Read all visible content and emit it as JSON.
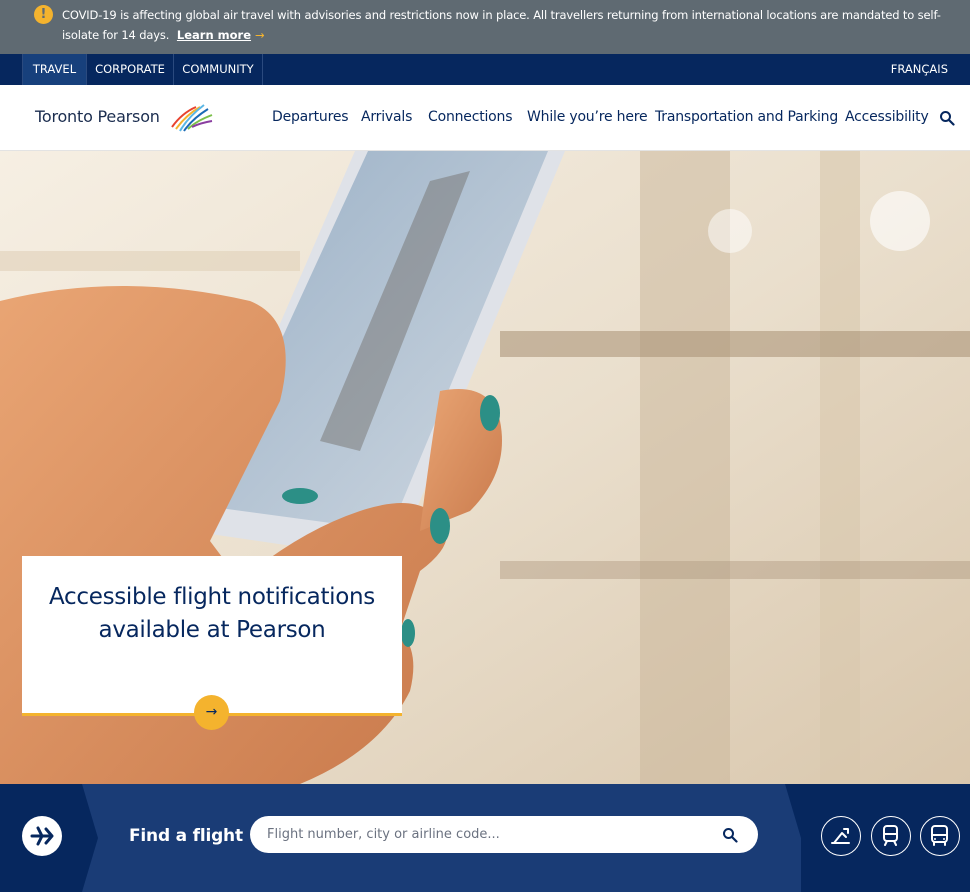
{
  "alert": {
    "icon": "exclamation-icon",
    "text": "COVID-19 is affecting global air travel with advisories and restrictions now in place. All travellers returning from international locations are mandated to self-isolate for 14 days.",
    "link_label": "Learn more",
    "link_arrow": "→"
  },
  "topnav": {
    "tabs": [
      {
        "label": "TRAVEL"
      },
      {
        "label": "CORPORATE"
      },
      {
        "label": "COMMUNITY"
      }
    ],
    "language": "FRANÇAIS"
  },
  "header": {
    "logo_text": "Toronto Pearson",
    "nav": [
      {
        "label": "Departures"
      },
      {
        "label": "Arrivals"
      },
      {
        "label": "Connections"
      },
      {
        "label": "While you’re here"
      },
      {
        "label": "Transportation and Parking"
      },
      {
        "label": "Accessibility"
      }
    ],
    "search_icon": "search-icon"
  },
  "hero": {
    "title": "Accessible flight notifications available at Pearson",
    "button_icon": "→"
  },
  "find_flight": {
    "label": "Find a flight",
    "placeholder": "Flight number, city or airline code...",
    "quick_links": [
      "parking-icon",
      "train-icon",
      "bus-icon"
    ]
  },
  "colors": {
    "navy": "#06275e",
    "accent_yellow": "#f4b32e",
    "alert_bg": "#5f6a72",
    "findbar_bg": "#1a3c76"
  }
}
